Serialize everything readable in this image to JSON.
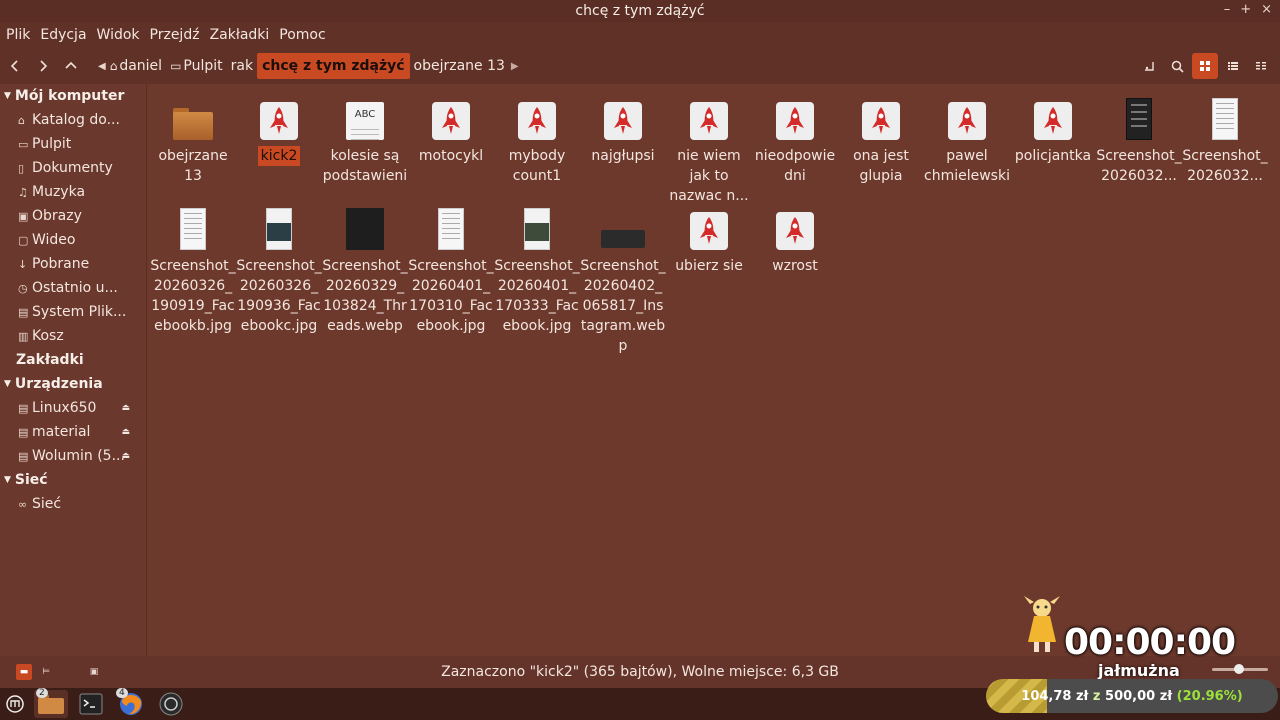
{
  "window": {
    "title": "chcę z tym zdążyć",
    "controls": [
      "–",
      "+",
      "×"
    ]
  },
  "menu": [
    "Plik",
    "Edycja",
    "Widok",
    "Przejdź",
    "Zakładki",
    "Pomoc"
  ],
  "breadcrumb": {
    "items": [
      "daniel",
      "Pulpit",
      "rak",
      "chcę z tym zdążyć",
      "obejrzane 13"
    ],
    "active_index": 3
  },
  "sidebar": {
    "computer_header": "Mój komputer",
    "computer_items": [
      "Katalog do...",
      "Pulpit",
      "Dokumenty",
      "Muzyka",
      "Obrazy",
      "Wideo",
      "Pobrane",
      "Ostatnio u...",
      "System Plik...",
      "Kosz"
    ],
    "bookmarks_header": "Zakładki",
    "devices_header": "Urządzenia",
    "devices": [
      "Linux650",
      "material",
      "Wolumin (5..."
    ],
    "network_header": "Sieć",
    "network_items": [
      "Sieć"
    ]
  },
  "files": [
    {
      "name": "obejrzane 13",
      "type": "folder"
    },
    {
      "name": "kick2",
      "type": "rocket",
      "selected": true
    },
    {
      "name": "kolesie są podstawieni",
      "type": "text"
    },
    {
      "name": "motocykl",
      "type": "rocket"
    },
    {
      "name": "mybody count1",
      "type": "rocket"
    },
    {
      "name": "najgłupsi",
      "type": "rocket"
    },
    {
      "name": "nie wiem jak to nazwac n...",
      "type": "rocket"
    },
    {
      "name": "nieodpowiedni",
      "type": "rocket"
    },
    {
      "name": "ona jest glupia",
      "type": "rocket"
    },
    {
      "name": "pawel chmielewski",
      "type": "rocket"
    },
    {
      "name": "policjantka",
      "type": "rocket"
    },
    {
      "name": "Screenshot_2026032...",
      "type": "shot-dark"
    },
    {
      "name": "Screenshot_2026032...",
      "type": "shot-white"
    },
    {
      "name": "Screenshot_20260326_190919_Facebookb.jpg",
      "type": "shot-white"
    },
    {
      "name": "Screenshot_20260326_190936_Facebookc.jpg",
      "type": "shot-mixed"
    },
    {
      "name": "Screenshot_20260329_103824_Threads.webp",
      "type": "shot-dark-wide"
    },
    {
      "name": "Screenshot_20260401_170310_Facebook.jpg",
      "type": "shot-white"
    },
    {
      "name": "Screenshot_20260401_170333_Facebook.jpg",
      "type": "shot-mixed2"
    },
    {
      "name": "Screenshot_20260402_065817_Instagram.webp",
      "type": "shot-insta"
    },
    {
      "name": "ubierz sie",
      "type": "rocket"
    },
    {
      "name": "wzrost",
      "type": "rocket"
    }
  ],
  "status": {
    "text": "Zaznaczono \"kick2\" (365 bajtów), Wolne miejsce: 6,3 GB"
  },
  "taskbar": {
    "files_badge": "2",
    "firefox_badge": "4"
  },
  "overlay": {
    "timer": "00:00:00",
    "donation_label": "jałmużna",
    "amount_current": "104,78 zł",
    "amount_sep": "z",
    "amount_goal": "500,00 zł",
    "amount_pct": "(20.96%)",
    "progress_fraction": 0.2096
  },
  "colors": {
    "accent": "#c94a22",
    "background": "#6d392d",
    "donation_pct": "#9ce23a"
  }
}
